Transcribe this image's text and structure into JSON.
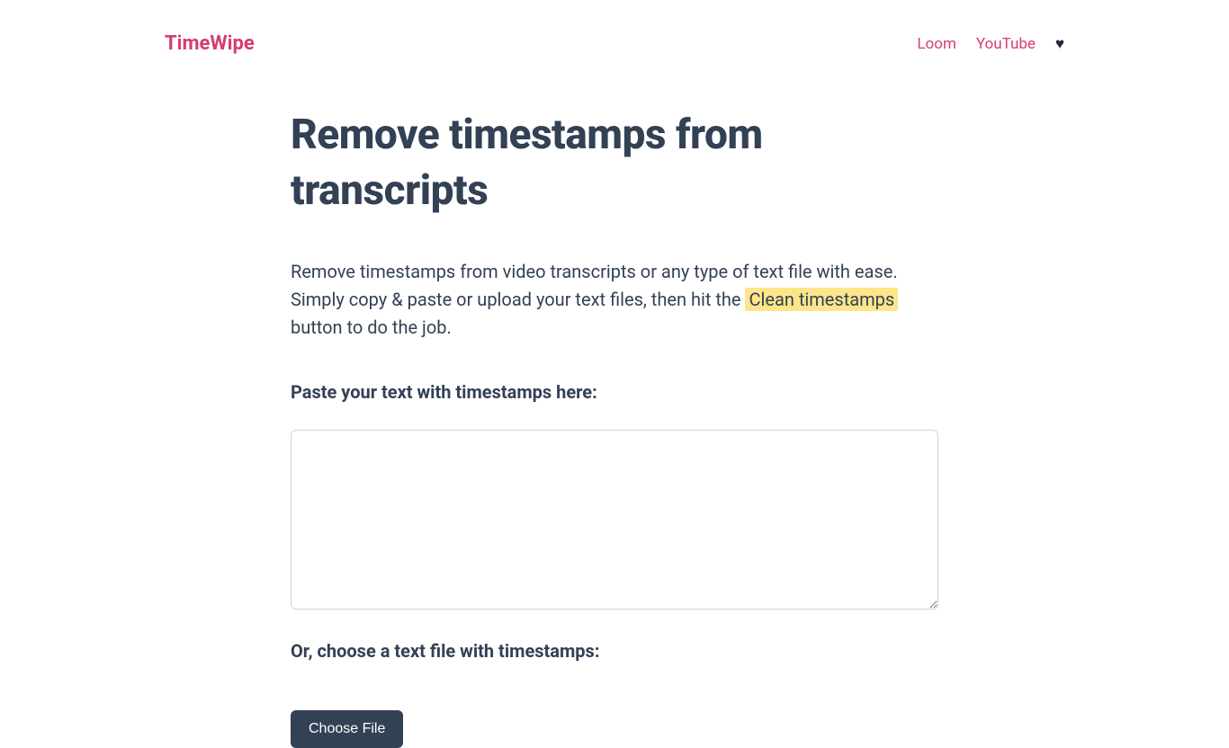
{
  "header": {
    "brand": "TimeWipe",
    "nav": {
      "loom": "Loom",
      "youtube": "YouTube"
    }
  },
  "main": {
    "title": "Remove timestamps from transcripts",
    "description_pre": "Remove timestamps from video transcripts or any type of text file with ease. Simply copy & paste or upload your text files, then hit the ",
    "highlight": "Clean timestamps",
    "description_post": " button to do the job.",
    "paste_label": "Paste your text with timestamps here:",
    "file_label": "Or, choose a text file with timestamps:",
    "file_button": "Choose File"
  }
}
